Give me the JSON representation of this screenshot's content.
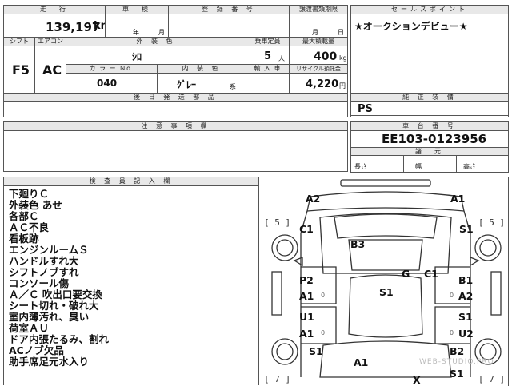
{
  "header": {
    "mileage_label": "走　行",
    "inspection_label": "車　検",
    "registration_label": "登 録 番 号",
    "transfer_deadline_label": "譲渡書類期限",
    "sales_point_label": "セールスポイント"
  },
  "vehicle": {
    "mileage": "139,197",
    "mileage_unit": "km",
    "inspection_year_suffix": "年",
    "inspection_month_suffix": "月",
    "transfer_month_suffix": "月",
    "transfer_day_suffix": "日",
    "sales_point": "★オークションデビュー★"
  },
  "specs": {
    "shift_label": "シフト",
    "aircon_label": "エアコン",
    "exterior_color_label": "外 装 色",
    "capacity_label": "乗車定員",
    "max_load_label": "最大積載量",
    "shift": "F5",
    "aircon": "AC",
    "exterior_color": "ｼﾛ",
    "capacity": "5",
    "capacity_unit": "人",
    "max_load": "400",
    "max_load_unit": "kg",
    "color_no_label": "カ ラ ー Ｎo.",
    "interior_color_label": "内 装 色",
    "import_label": "輸 入 車",
    "recycle_label": "リサイクル預託金",
    "color_no": "040",
    "interior_color": "ｸﾞﾚｰ",
    "interior_suffix": "系",
    "recycle_fee": "4,220",
    "recycle_unit": "円"
  },
  "sections": {
    "later_docs_label": "後 日 発 送 部 品",
    "genuine_equipment_label": "純 正 装 備",
    "genuine_equipment": "PS",
    "caution_label": "注 意 事 項 欄",
    "chassis_label": "車 台 番 号",
    "chassis_number": "EE103-0123956",
    "dimensions_label": "諸　元",
    "length_label": "長さ",
    "width_label": "幅",
    "height_label": "高さ",
    "inspector_label": "検 査 員 記 入 欄"
  },
  "inspector_notes": [
    "下廻りＣ",
    "外装色 あせ",
    "各部Ｃ",
    "ＡＣ不良",
    "看板跡",
    "エンジンルームＳ",
    "ハンドルすれ大",
    "シフトノブすれ",
    "コンソール傷",
    "Ａ／Ｃ 吹出口要交換",
    "シート切れ・破れ大",
    "室内薄汚れ、臭い",
    "荷室ＡＵ",
    "ドア内張たるみ、割れ",
    "ACノブ欠品",
    "助手席足元水入り"
  ],
  "diagram": {
    "labels": [
      "A2",
      "A1",
      "C1",
      "S1",
      "B3",
      "G",
      "C1",
      "P2",
      "A1",
      "S1",
      "B1",
      "A2",
      "U1",
      "A1",
      "S1",
      "U2",
      "S1",
      "B2",
      "A1",
      "X",
      "S1"
    ],
    "brackets": [
      "[ 5 ]",
      "[ 5 ]",
      "[ 7 ]",
      "[ 7 ]"
    ],
    "zero_marks": [
      "0",
      "0",
      "0",
      "0"
    ]
  },
  "watermark": "WEB-STUDIO.PRO",
  "colors": {
    "border": "#555555",
    "header_bg": "#e8e8e8",
    "text": "#111111"
  }
}
